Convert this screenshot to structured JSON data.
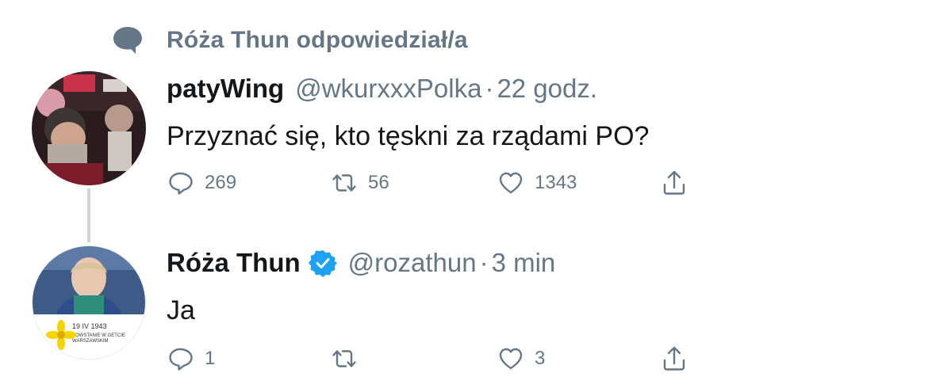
{
  "context": {
    "label": "Róża Thun odpowiedział/a",
    "icon": "speech-bubble-icon"
  },
  "tweets": [
    {
      "name": "patyWing",
      "handle": "@wkurxxxPolka",
      "separator": "·",
      "time": "22 godz.",
      "text": "Przyznać się, kto tęskni za rządami PO?",
      "reply_count": "269",
      "retweet_count": "56",
      "like_count": "1343",
      "verified": false
    },
    {
      "name": "Róża Thun",
      "handle": "@rozathun",
      "separator": "·",
      "time": "3 min",
      "text": "Ja",
      "reply_count": "1",
      "retweet_count": "",
      "like_count": "3",
      "verified": true,
      "avatar_caption": [
        "19 IV 1943",
        "POWSTANIE W GETCIE",
        "WARSZAWSKIM"
      ]
    }
  ],
  "colors": {
    "secondary_text": "#657786",
    "primary_text": "#14171a",
    "verified_blue": "#1da1f2",
    "thread_line": "#ccd6dd"
  }
}
